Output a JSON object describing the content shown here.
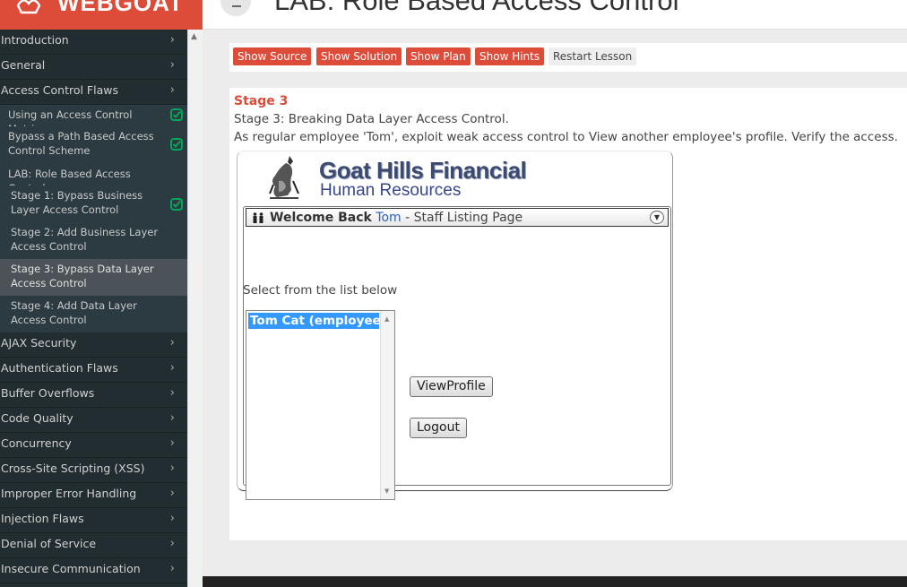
{
  "brand": {
    "name": "WEBGOAT"
  },
  "header": {
    "title": "LAB: Role Based Access Control"
  },
  "sidebar": {
    "categories_top": [
      {
        "label": "Introduction"
      },
      {
        "label": "General"
      },
      {
        "label": "Access Control Flaws"
      }
    ],
    "lessons": [
      {
        "label": "Using an Access Control Matrix",
        "completed": true
      },
      {
        "label": "Bypass a Path Based Access Control Scheme",
        "completed": true
      },
      {
        "label": "LAB: Role Based Access Control",
        "completed": false
      }
    ],
    "stages": [
      {
        "label": "Stage 1: Bypass Business Layer Access Control",
        "completed": true
      },
      {
        "label": "Stage 2: Add Business Layer Access Control",
        "completed": false
      },
      {
        "label": "Stage 3: Bypass Data Layer Access Control",
        "completed": false,
        "active": true
      },
      {
        "label": "Stage 4: Add Data Layer Access Control",
        "completed": false
      }
    ],
    "categories_bottom": [
      {
        "label": "AJAX Security"
      },
      {
        "label": "Authentication Flaws"
      },
      {
        "label": "Buffer Overflows"
      },
      {
        "label": "Code Quality"
      },
      {
        "label": "Concurrency"
      },
      {
        "label": "Cross-Site Scripting (XSS)"
      },
      {
        "label": "Improper Error Handling"
      },
      {
        "label": "Injection Flaws"
      },
      {
        "label": "Denial of Service"
      },
      {
        "label": "Insecure Communication"
      }
    ],
    "chevron": "›"
  },
  "toolbar": {
    "show_source": "Show Source",
    "show_solution": "Show Solution",
    "show_plan": "Show Plan",
    "show_hints": "Show Hints",
    "restart_lesson": "Restart Lesson"
  },
  "lesson": {
    "stage_title": "Stage 3",
    "stage_description": "Stage 3: Breaking Data Layer Access Control.",
    "instruction": "As regular employee 'Tom', exploit weak access control to View another employee's profile. Verify the access."
  },
  "app": {
    "company": "Goat Hills Financial",
    "department": "Human Resources",
    "welcome_prefix": "Welcome Back",
    "user_name": "Tom",
    "page_suffix": " - Staff Listing Page",
    "select_label": "Select from the list below",
    "employees": [
      "Tom Cat (employee)"
    ],
    "view_profile_label": "ViewProfile",
    "logout_label": "Logout"
  },
  "colors": {
    "accent": "#dd4b39",
    "sidebar_bg": "#222d32",
    "completed_check": "#00a65a",
    "selection": "#3399ff"
  }
}
